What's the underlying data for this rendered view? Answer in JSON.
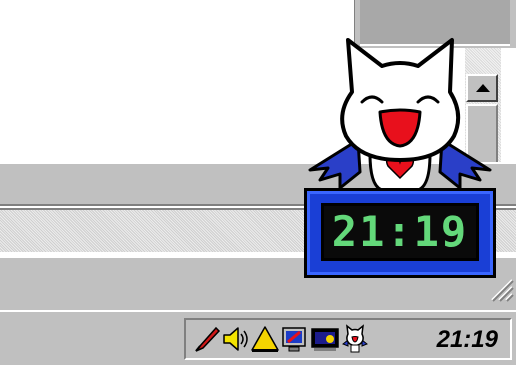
{
  "overlay_clock": {
    "time": "21:19",
    "digit_color": "#63d87a",
    "frame_color": "#1a3fd6"
  },
  "taskbar": {
    "clock": "21:19",
    "tray_icons": [
      "pen-icon",
      "speaker-icon",
      "warning-triangle-icon",
      "monitor-edit-icon",
      "display-settings-icon",
      "cat-mascot-icon"
    ]
  },
  "colors": {
    "face_background": "#c0c0c0",
    "mascot_wing": "#2a3fc8",
    "mascot_mouth": "#e8101c"
  }
}
